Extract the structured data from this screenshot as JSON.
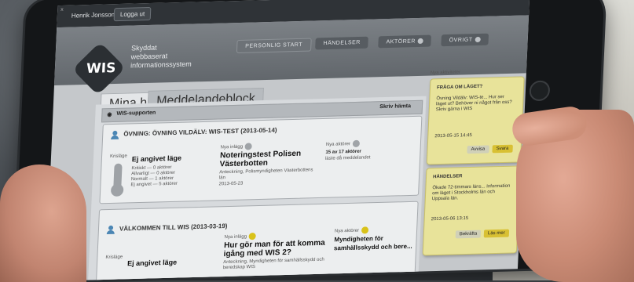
{
  "topbar": {
    "user": "Henrik Jonsson",
    "logout": "Logga ut",
    "close": "x"
  },
  "brand": {
    "logo": "WIS",
    "tagline": [
      "Skyddat",
      "webbaserat",
      "informationssystem"
    ]
  },
  "nav": [
    {
      "label": "PERSONLIG START",
      "active": true
    },
    {
      "label": "HÄNDELSER",
      "active": false
    },
    {
      "label": "AKTÖRER",
      "active": false
    },
    {
      "label": "ÖVRIGT",
      "active": false
    }
  ],
  "tabs": [
    "Mina händelser",
    "Meddelandeblock"
  ],
  "section": {
    "title": "WIS-supporten",
    "action": "Skriv hämta"
  },
  "cards": [
    {
      "title": "ÖVNING: ÖVNING VILDÄLV: WIS-TEST (2013-05-14)",
      "status_label": "Ej angivet läge",
      "status_caption": "Krisläge",
      "legend": [
        {
          "label": "Kritiskt",
          "count": "0 aktörer"
        },
        {
          "label": "Allvarligt",
          "count": "0 aktörer"
        },
        {
          "label": "Normalt",
          "count": "1 aktörer"
        },
        {
          "label": "Ej angivet",
          "count": "5 aktörer"
        }
      ],
      "news_label": "Nya inlägg",
      "news_title": "Noteringstest Polisen Västerbotten",
      "news_meta": "Anteckning, Polismyndigheten Västerbottens län",
      "news_date": "2013-05-23",
      "actors_label": "Nya aktörer",
      "actors_text": "15 av 17 aktörer",
      "actors_sub": "läste då meddelandet"
    },
    {
      "title": "VÄLKOMMEN TILL WIS (2013-03-19)",
      "status_label": "Ej angivet läge",
      "status_caption": "Krisläge",
      "news_label": "Nya inlägg",
      "news_title": "Hur gör man för att komma igång med WIS 2?",
      "news_meta": "Anteckning, Myndigheten för samhällsskydd och beredskap WIS",
      "actors_label": "Nya aktörer",
      "actors_text": "Myndigheten för samhällsskydd och bere..."
    }
  ],
  "sidebar": {
    "title": "Nya aktiviteter",
    "notes": [
      {
        "title": "FRÅGA OM LÄGET?",
        "body": "Övning Vildälv: WIS-te... Hur ser läget ut? Behöver ni något från oss? Skriv gärna i WIS",
        "date": "2013-05-15 14:45",
        "ok": "Avvisa",
        "primary": "Svara"
      },
      {
        "title": "HÄNDELSER",
        "body": "Ökade 72-timmars läns... Information om läget i Stockholms län och Uppsala län.",
        "date": "2013-05-06 13:15",
        "ok": "Bekräfta",
        "primary": "Läs mer"
      }
    ]
  }
}
